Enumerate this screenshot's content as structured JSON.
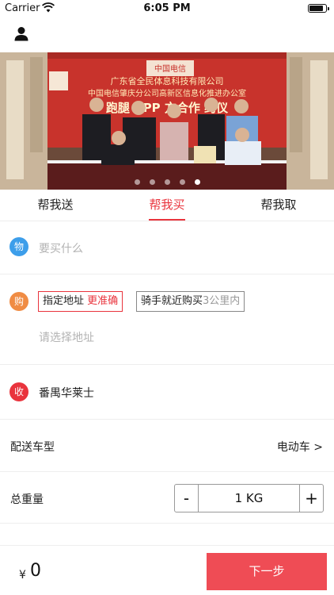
{
  "status_bar": {
    "carrier": "Carrier",
    "time": "6:05 PM",
    "battery_level": 0.85
  },
  "nav": {
    "icon": "user-icon"
  },
  "banner": {
    "line1": "广东省全民体息科技有限公司",
    "line2": "中国电信肇庆分公司高新区信息化推进办公室",
    "line3": "跑腿     APP      方合作     约仪",
    "logo_text": "中国电信",
    "slide_count": 5,
    "active_slide": 5
  },
  "tabs": [
    {
      "label": "帮我送",
      "active": false
    },
    {
      "label": "帮我买",
      "active": true
    },
    {
      "label": "帮我取",
      "active": false
    }
  ],
  "item_row": {
    "badge": "物",
    "placeholder": "要买什么"
  },
  "buy_row": {
    "badge": "购",
    "chip_selected_main": "指定地址",
    "chip_selected_accent": "更准确",
    "chip_plain_main": "骑手就近购买",
    "chip_plain_muted": "3公里内",
    "address_placeholder": "请选择地址"
  },
  "receive_row": {
    "badge": "收",
    "value": "番禺华莱士"
  },
  "vehicle_row": {
    "label": "配送车型",
    "value": "电动车 >"
  },
  "weight_row": {
    "label": "总重量",
    "minus": "-",
    "value": "1 KG",
    "plus": "+"
  },
  "bottom": {
    "currency": "¥",
    "price": "0",
    "next_label": "下一步"
  },
  "colors": {
    "accent": "#e9343d",
    "badge_blue": "#3d9eea",
    "badge_orange": "#f08c44",
    "button": "#ef4c55"
  }
}
